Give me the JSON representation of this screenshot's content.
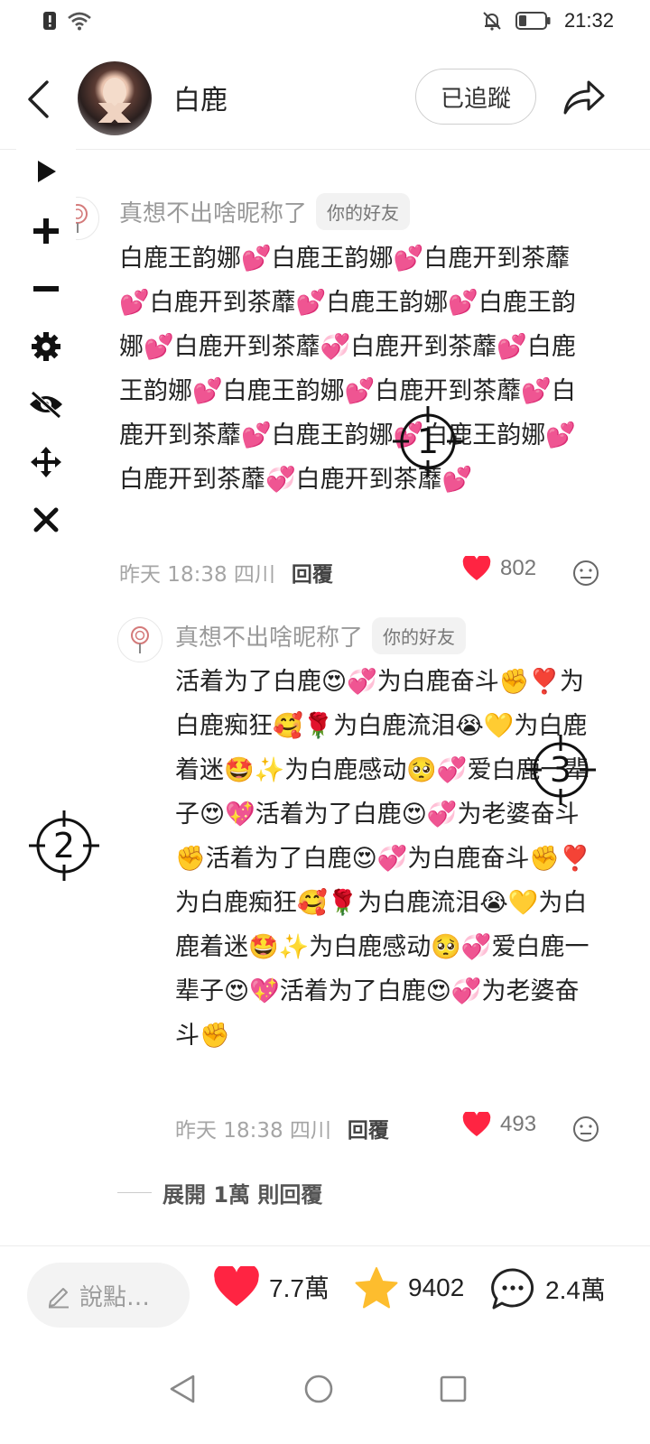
{
  "status_bar": {
    "time": "21:32"
  },
  "header": {
    "author_name": "白鹿",
    "follow_label": "已追蹤"
  },
  "comments": [
    {
      "nickname": "真想不出啥昵称了",
      "tag": "你的好友",
      "text": "白鹿王韵娜💕白鹿王韵娜💕白鹿开到茶蘼💕白鹿开到茶蘼💕白鹿王韵娜💕白鹿王韵娜💕白鹿开到茶蘼💞白鹿开到茶蘼💕白鹿王韵娜💕白鹿王韵娜💕白鹿开到茶蘼💕白鹿开到茶蘼💕白鹿王韵娜💕白鹿王韵娜💕白鹿开到茶蘼💞白鹿开到茶蘼💕",
      "time": "昨天 18:38 四川",
      "reply_label": "回覆",
      "likes": "802"
    },
    {
      "nickname": "真想不出啥昵称了",
      "tag": "你的好友",
      "text": "活着为了白鹿😍💞为白鹿奋斗✊❣️为白鹿痴狂🥰🌹为白鹿流泪😭💛为白鹿着迷🤩✨为白鹿感动🥺💞爱白鹿一辈子😍💖活着为了白鹿😍💞为老婆奋斗✊活着为了白鹿😍💞为白鹿奋斗✊❣️为白鹿痴狂🥰🌹为白鹿流泪😭💛为白鹿着迷🤩✨为白鹿感动🥺💞爱白鹿一辈子😍💖活着为了白鹿😍💞为老婆奋斗✊",
      "time": "昨天 18:38 四川",
      "reply_label": "回覆",
      "likes": "493"
    }
  ],
  "expand_replies": "展開 1萬 則回覆",
  "markers": [
    "1",
    "2",
    "3"
  ],
  "bottom_bar": {
    "input_placeholder": "說點…",
    "likes": "7.7萬",
    "favorites": "9402",
    "comments": "2.4萬"
  },
  "colors": {
    "like_red": "#ff2442",
    "star_yellow": "#fdbd2e"
  }
}
